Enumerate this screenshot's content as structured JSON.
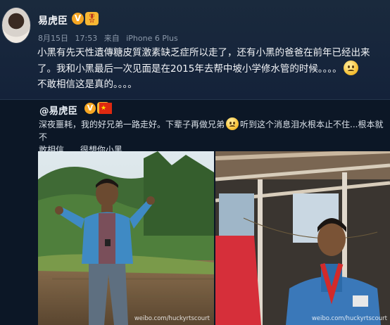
{
  "post": {
    "author": "易虎臣",
    "verified_badge": "V",
    "member_badge": "🎖",
    "date": "8月15日",
    "time": "17:53",
    "source_prefix": "来自",
    "source": "iPhone 6 Plus",
    "text_line1": "小黑有先天性遺傳糖皮質激素缺乏症所以走了，还有小黑的爸爸在前年已经出来",
    "text_line2": "了。我和小黑最后一次见面是在2015年去帮中坡小学修水管的时候。。。。",
    "text_line3": "不敢相信这是真的。。。。"
  },
  "repost": {
    "mention": "@易虎臣",
    "verified_badge": "V",
    "member_badge": "🎖",
    "flag": "★",
    "text_part1": "深夜噩耗，我的好兄弟一路走好。下辈子再做兄弟",
    "text_part2": "听到这个消息泪水根本止不住...根本就不",
    "text_line2": "敢相信......很想你小黑......."
  },
  "images": {
    "left_watermark": "weibo.com/huckyrtscourt",
    "right_watermark": "weibo.com/huckyrtscourt"
  },
  "colors": {
    "background": "#101c2a",
    "verified": "#f5a623",
    "text_primary": "#f2f4f7",
    "text_meta": "#8d9aab"
  }
}
